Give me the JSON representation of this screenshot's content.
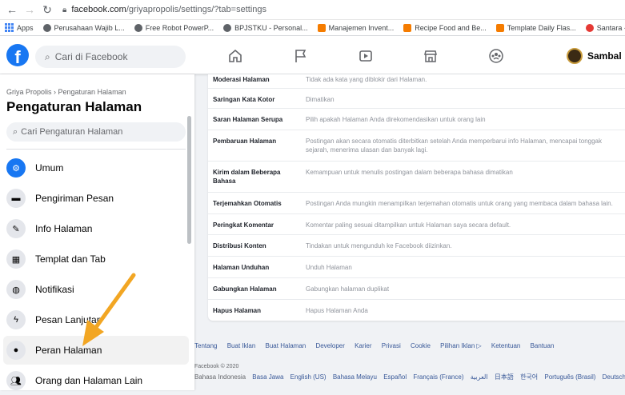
{
  "browser": {
    "url_host": "facebook.com",
    "url_path": "/griyapropolis/settings/?tab=settings",
    "bookmarks": [
      {
        "label": "Apps",
        "icon": "apps-icon"
      },
      {
        "label": "Perusahaan Wajib L...",
        "icon": "globe-icon"
      },
      {
        "label": "Free Robot PowerP...",
        "icon": "globe-icon"
      },
      {
        "label": "BPJSTKU - Personal...",
        "icon": "globe-icon"
      },
      {
        "label": "Manajemen Invent...",
        "icon": "orange-doc-icon"
      },
      {
        "label": "Recipe Food and Be...",
        "icon": "orange-doc-icon"
      },
      {
        "label": "Template Daily Flas...",
        "icon": "orange-doc-icon"
      },
      {
        "label": "Santara - Bursa Sah...",
        "icon": "santara-icon"
      }
    ]
  },
  "header": {
    "logo": "f",
    "search_placeholder": "Cari di Facebook",
    "profile_name": "Sambal"
  },
  "sidebar": {
    "breadcrumb": "Griya Propolis › Pengaturan Halaman",
    "title": "Pengaturan Halaman",
    "search_placeholder": "Cari Pengaturan Halaman",
    "items": [
      {
        "label": "Umum",
        "icon": "gear-icon"
      },
      {
        "label": "Pengiriman Pesan",
        "icon": "chat-icon"
      },
      {
        "label": "Info Halaman",
        "icon": "pencil-icon"
      },
      {
        "label": "Templat dan Tab",
        "icon": "grid-icon"
      },
      {
        "label": "Notifikasi",
        "icon": "globe-icon"
      },
      {
        "label": "Pesan Lanjutan",
        "icon": "messenger-icon"
      },
      {
        "label": "Peran Halaman",
        "icon": "person-icon"
      },
      {
        "label": "Orang dan Halaman Lain",
        "icon": "people-icon"
      }
    ]
  },
  "settings": [
    {
      "key": "Moderasi Halaman",
      "value": "Tidak ada kata yang diblokir dari Halaman."
    },
    {
      "key": "Saringan Kata Kotor",
      "value": "Dimatikan"
    },
    {
      "key": "Saran Halaman Serupa",
      "value": "Pilih apakah Halaman Anda direkomendasikan untuk orang lain"
    },
    {
      "key": "Pembaruan Halaman",
      "value": "Postingan akan secara otomatis diterbitkan setelah Anda memperbarui info Halaman, mencapai tonggak sejarah, menerima ulasan dan banyak lagi."
    },
    {
      "key": "Kirim dalam Beberapa Bahasa",
      "value": "Kemampuan untuk menulis postingan dalam beberapa bahasa dimatikan"
    },
    {
      "key": "Terjemahkan Otomatis",
      "value": "Postingan Anda mungkin menampilkan terjemahan otomatis untuk orang yang membaca dalam bahasa lain."
    },
    {
      "key": "Peringkat Komentar",
      "value": "Komentar paling sesuai ditampilkan untuk Halaman saya secara default."
    },
    {
      "key": "Distribusi Konten",
      "value": "Tindakan untuk mengunduh ke Facebook diizinkan."
    },
    {
      "key": "Halaman Unduhan",
      "value": "Unduh Halaman"
    },
    {
      "key": "Gabungkan Halaman",
      "value": "Gabungkan halaman duplikat"
    },
    {
      "key": "Hapus Halaman",
      "value": "Hapus Halaman Anda"
    }
  ],
  "footer": {
    "links": [
      "Tentang",
      "Buat Iklan",
      "Buat Halaman",
      "Developer",
      "Karier",
      "Privasi",
      "Cookie",
      "Pilihan Iklan ▷",
      "Ketentuan",
      "Bantuan"
    ],
    "copyright": "Facebook © 2020",
    "current_language": "Bahasa Indonesia",
    "languages": [
      "Basa Jawa",
      "English (US)",
      "Bahasa Melayu",
      "Español",
      "Français (France)",
      "العربية",
      "日本語",
      "한국어",
      "Português (Brasil)",
      "Deutsch"
    ]
  },
  "annotation_color": "#f2a623"
}
